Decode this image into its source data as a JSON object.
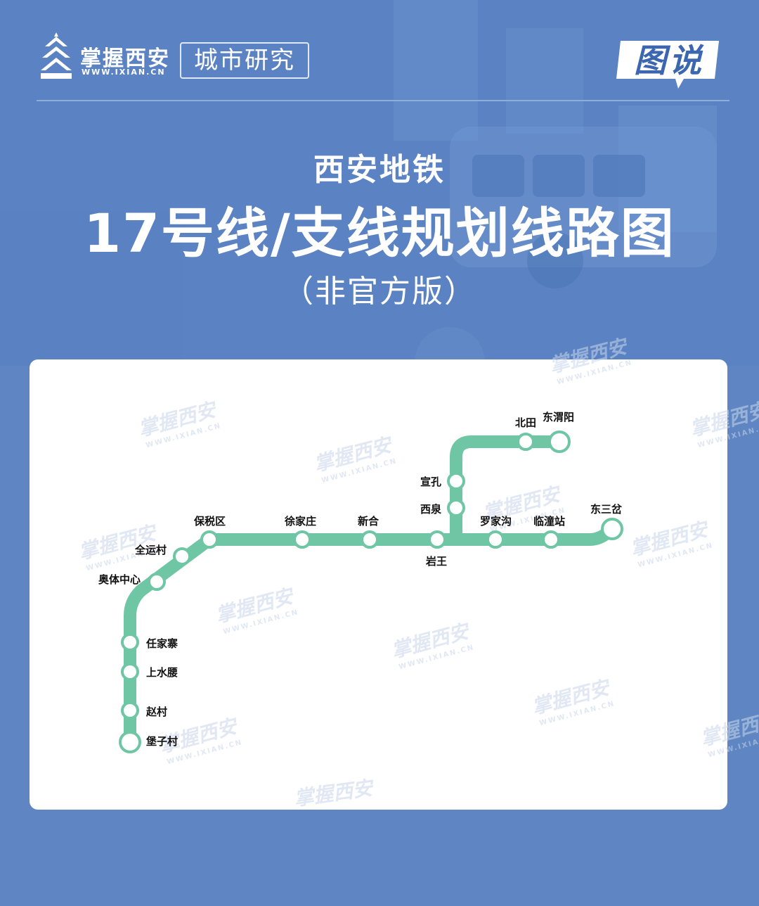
{
  "colors": {
    "background": "#5f86c3",
    "line": "#6fc6a4",
    "station_fill": "#ffffff",
    "card": "#ffffff",
    "watermark": "#c9d7ea"
  },
  "header": {
    "brand_name": "掌握西安",
    "brand_url": "WWW.IXIAN.CN",
    "section_tag": "城市研究",
    "badge": "图说",
    "logo_icon": "pagoda-icon"
  },
  "title": {
    "sub": "西安地铁",
    "main": "17号线/支线规划线路图",
    "note": "（非官方版）"
  },
  "watermark": {
    "text": "掌握西安",
    "url": "WWW.IXIAN.CN"
  },
  "map": {
    "line_name": "17号线/支线",
    "stations": [
      {
        "id": "baozicun",
        "name": "堡子村",
        "terminal": true
      },
      {
        "id": "zhaocun",
        "name": "赵村"
      },
      {
        "id": "shangshuiyao",
        "name": "上水腰"
      },
      {
        "id": "renjiazhai",
        "name": "任家寨"
      },
      {
        "id": "aotizhongxin",
        "name": "奥体中心"
      },
      {
        "id": "quanyuncun",
        "name": "全运村"
      },
      {
        "id": "baoshuiqu",
        "name": "保税区"
      },
      {
        "id": "xujiazhuang",
        "name": "徐家庄"
      },
      {
        "id": "xinhe",
        "name": "新合"
      },
      {
        "id": "yanwang",
        "name": "岩王"
      },
      {
        "id": "luojiagou",
        "name": "罗家沟"
      },
      {
        "id": "lintongzhan",
        "name": "临潼站"
      },
      {
        "id": "dongsancha",
        "name": "东三岔",
        "terminal": true
      },
      {
        "id": "xiquan",
        "name": "西泉"
      },
      {
        "id": "xuankong",
        "name": "宣孔"
      },
      {
        "id": "beitian",
        "name": "北田"
      },
      {
        "id": "dongweiyang",
        "name": "东渭阳",
        "terminal": true
      }
    ]
  }
}
